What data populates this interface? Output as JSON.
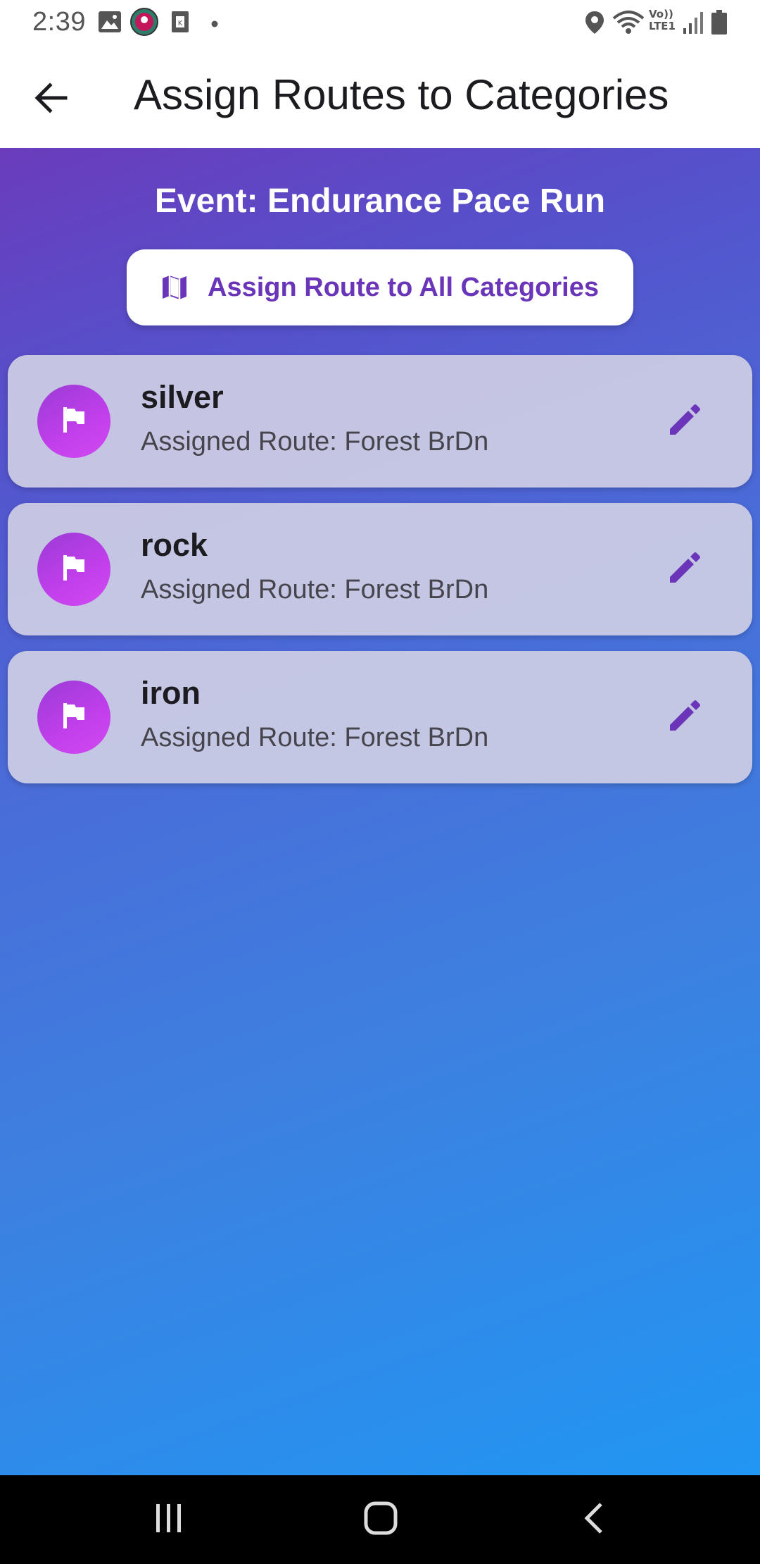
{
  "status_bar": {
    "time": "2:39",
    "icons": [
      "image-icon",
      "app-badge-icon",
      "sim-icon",
      "dot-icon",
      "location-icon",
      "wifi-icon",
      "volte-icon",
      "signal-icon",
      "battery-icon"
    ],
    "volte_text_top": "Vo))",
    "volte_text_bottom": "LTE1"
  },
  "app_bar": {
    "title": "Assign Routes to Categories",
    "back_icon": "arrow-back-icon"
  },
  "event": {
    "title": "Event: Endurance Pace Run"
  },
  "assign_all": {
    "label": "Assign Route to All Categories",
    "icon": "map-icon"
  },
  "categories": [
    {
      "name": "silver",
      "route": "Assigned Route: Forest BrDn",
      "icon": "flag-icon",
      "action_icon": "edit-icon"
    },
    {
      "name": "rock",
      "route": "Assigned Route: Forest BrDn",
      "icon": "flag-icon",
      "action_icon": "edit-icon"
    },
    {
      "name": "iron",
      "route": "Assigned Route: Forest BrDn",
      "icon": "flag-icon",
      "action_icon": "edit-icon"
    }
  ],
  "nav_bar": {
    "buttons": [
      "recent-apps-icon",
      "home-icon",
      "back-nav-icon"
    ]
  },
  "colors": {
    "accent": "#6a35b8",
    "gradient_start": "#6a3cbc",
    "gradient_end": "#2196f3",
    "avatar": "#c23fec"
  }
}
